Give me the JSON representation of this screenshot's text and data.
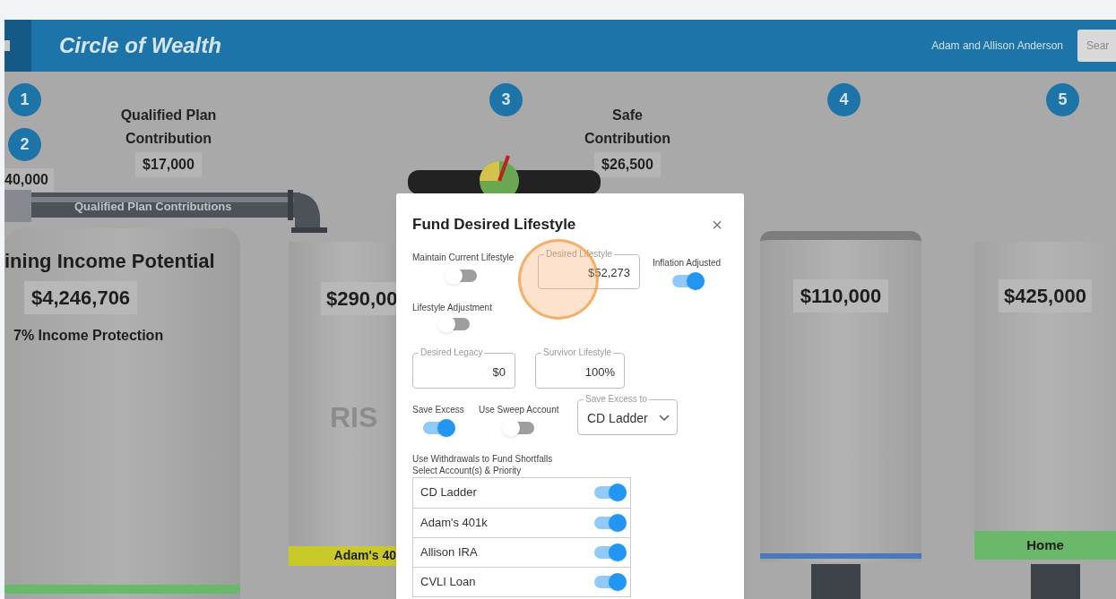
{
  "header": {
    "title": "Circle of Wealth",
    "user": "Adam and Allison Anderson",
    "search_placeholder": "Sear"
  },
  "steps": [
    "1",
    "2",
    "3",
    "4",
    "5"
  ],
  "contributions": [
    {
      "title": "Qualified Plan Contribution",
      "amount": "$17,000"
    },
    {
      "title": "Safe Contribution",
      "amount": "$26,500"
    }
  ],
  "side_amount": "40,000",
  "pipe_label": "Qualified Plan Contributions",
  "tanks": [
    {
      "title": "ining Income Potential",
      "amount": "$4,246,706",
      "subtitle": "7% Income Protection",
      "color": "#6ab86a"
    },
    {
      "amount": "$290,00",
      "watermark": "RIS",
      "label": "Adam's 40",
      "color": "#c9c92a"
    },
    {
      "amount": "$110,000",
      "color": "#4a78b8"
    },
    {
      "amount": "$425,000",
      "label": "Home",
      "color": "#6ab86a"
    }
  ],
  "modal": {
    "title": "Fund Desired Lifestyle",
    "close": "×",
    "maintain_current": {
      "label": "Maintain Current Lifestyle",
      "on": false
    },
    "desired_lifestyle": {
      "label": "Desired Lifestyle",
      "value": "$52,273"
    },
    "inflation_adjusted": {
      "label": "Inflation Adjusted",
      "on": true
    },
    "lifestyle_adjustment": {
      "label": "Lifestyle Adjustment",
      "on": false
    },
    "desired_legacy": {
      "label": "Desired Legacy",
      "value": "$0"
    },
    "survivor_lifestyle": {
      "label": "Survivor Lifestyle",
      "value": "100%"
    },
    "save_excess": {
      "label": "Save Excess",
      "on": true
    },
    "sweep_account": {
      "label": "Use Sweep Account",
      "on": false
    },
    "save_excess_to": {
      "label": "Save Excess to",
      "value": "CD Ladder"
    },
    "instructions": [
      "Use Withdrawals to Fund Shortfalls",
      "Select Account(s) & Priority"
    ],
    "accounts": [
      {
        "name": "CD Ladder",
        "on": true
      },
      {
        "name": "Adam's 401k",
        "on": true
      },
      {
        "name": "Allison IRA",
        "on": true
      },
      {
        "name": "CVLI Loan",
        "on": true
      }
    ]
  }
}
